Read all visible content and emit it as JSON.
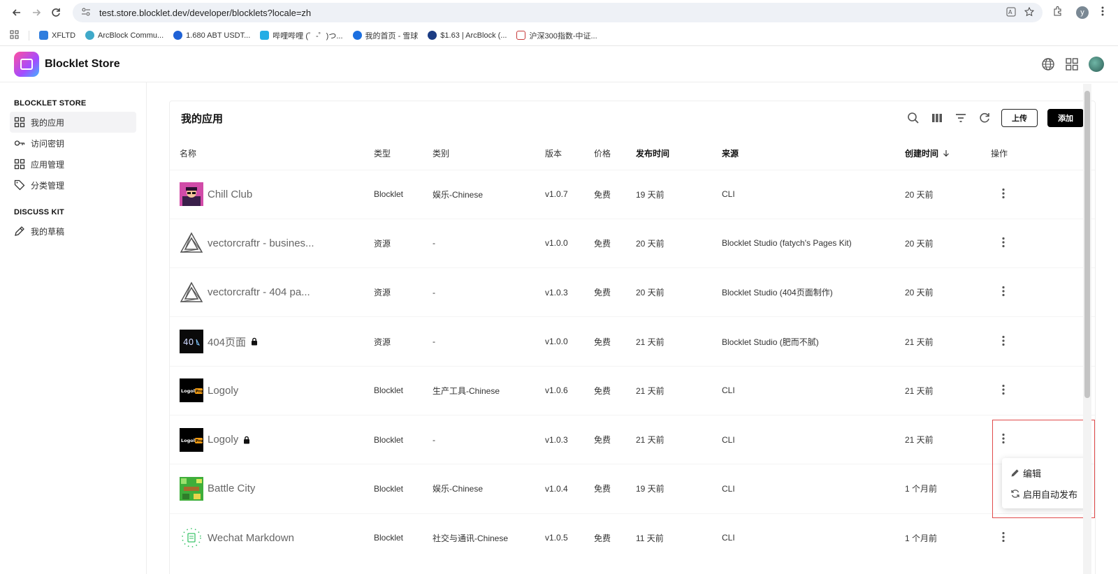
{
  "browser": {
    "url": "test.store.blocklet.dev/developer/blocklets?locale=zh",
    "profile_initial": "y",
    "bookmarks": [
      {
        "label": "XFLTD",
        "color": "#2f7dde"
      },
      {
        "label": "ArcBlock Commu...",
        "color": "#3fa9c9"
      },
      {
        "label": "1.680 ABT USDT...",
        "color": "#1f62d6"
      },
      {
        "label": "哔哩哔哩 (゜-゜)つ...",
        "color": "#23ade5"
      },
      {
        "label": "我的首页 - 雪球",
        "color": "#1b6fe0"
      },
      {
        "label": "$1.63 | ArcBlock (...",
        "color": "#1b3c83"
      },
      {
        "label": "沪深300指数-中证...",
        "color": "#c73838"
      }
    ]
  },
  "header": {
    "brand": "Blocklet Store"
  },
  "sidebar": {
    "sections": [
      {
        "title": "BLOCKLET STORE",
        "items": [
          {
            "label": "我的应用",
            "icon": "grid-icon",
            "active": true
          },
          {
            "label": "访问密钥",
            "icon": "key-icon"
          },
          {
            "label": "应用管理",
            "icon": "grid-icon"
          },
          {
            "label": "分类管理",
            "icon": "tag-icon"
          }
        ]
      },
      {
        "title": "DISCUSS KIT",
        "items": [
          {
            "label": "我的草稿",
            "icon": "pencil-icon"
          }
        ]
      }
    ]
  },
  "card": {
    "title": "我的应用",
    "upload_label": "上传",
    "add_label": "添加"
  },
  "table": {
    "columns": [
      "名称",
      "类型",
      "类别",
      "版本",
      "价格",
      "发布时间",
      "来源",
      "创建时间",
      "操作"
    ],
    "rows": [
      {
        "name": "Chill Club",
        "type": "Blocklet",
        "category": "娱乐-Chinese",
        "version": "v1.0.7",
        "price": "免费",
        "published": "19 天前",
        "source": "CLI",
        "created": "20 天前",
        "thumb": "chill",
        "locked": false
      },
      {
        "name": "vectorcraftr - busines...",
        "type": "资源",
        "category": "-",
        "version": "v1.0.0",
        "price": "免费",
        "published": "20 天前",
        "source": "Blocklet Studio (fatych's Pages Kit)",
        "created": "20 天前",
        "thumb": "triangle",
        "locked": false
      },
      {
        "name": "vectorcraftr - 404 pa...",
        "type": "资源",
        "category": "-",
        "version": "v1.0.3",
        "price": "免费",
        "published": "20 天前",
        "source": "Blocklet Studio (404页面制作)",
        "created": "20 天前",
        "thumb": "triangle",
        "locked": false
      },
      {
        "name": "404页面",
        "type": "资源",
        "category": "-",
        "version": "v1.0.0",
        "price": "免费",
        "published": "21 天前",
        "source": "Blocklet Studio (肥而不腻)",
        "created": "21 天前",
        "thumb": "dark404",
        "locked": true
      },
      {
        "name": "Logoly",
        "type": "Blocklet",
        "category": "生产工具-Chinese",
        "version": "v1.0.6",
        "price": "免费",
        "published": "21 天前",
        "source": "CLI",
        "created": "21 天前",
        "thumb": "logoly",
        "locked": false
      },
      {
        "name": "Logoly",
        "type": "Blocklet",
        "category": "-",
        "version": "v1.0.3",
        "price": "免费",
        "published": "21 天前",
        "source": "CLI",
        "created": "21 天前",
        "thumb": "logoly",
        "locked": true
      },
      {
        "name": "Battle City",
        "type": "Blocklet",
        "category": "娱乐-Chinese",
        "version": "v1.0.4",
        "price": "免费",
        "published": "19 天前",
        "source": "CLI",
        "created": "1 个月前",
        "thumb": "battle",
        "locked": false
      },
      {
        "name": "Wechat Markdown",
        "type": "Blocklet",
        "category": "社交与通讯-Chinese",
        "version": "v1.0.5",
        "price": "免费",
        "published": "11 天前",
        "source": "CLI",
        "created": "1 个月前",
        "thumb": "wechat",
        "locked": false
      }
    ]
  },
  "thumb_texts": {
    "logoly": "Logoly",
    "logoly_badge": "Pro",
    "dark404": "40"
  },
  "context_menu": {
    "items": [
      {
        "label": "编辑",
        "icon": "pencil-icon"
      },
      {
        "label": "启用自动发布",
        "icon": "sync-icon"
      }
    ]
  }
}
